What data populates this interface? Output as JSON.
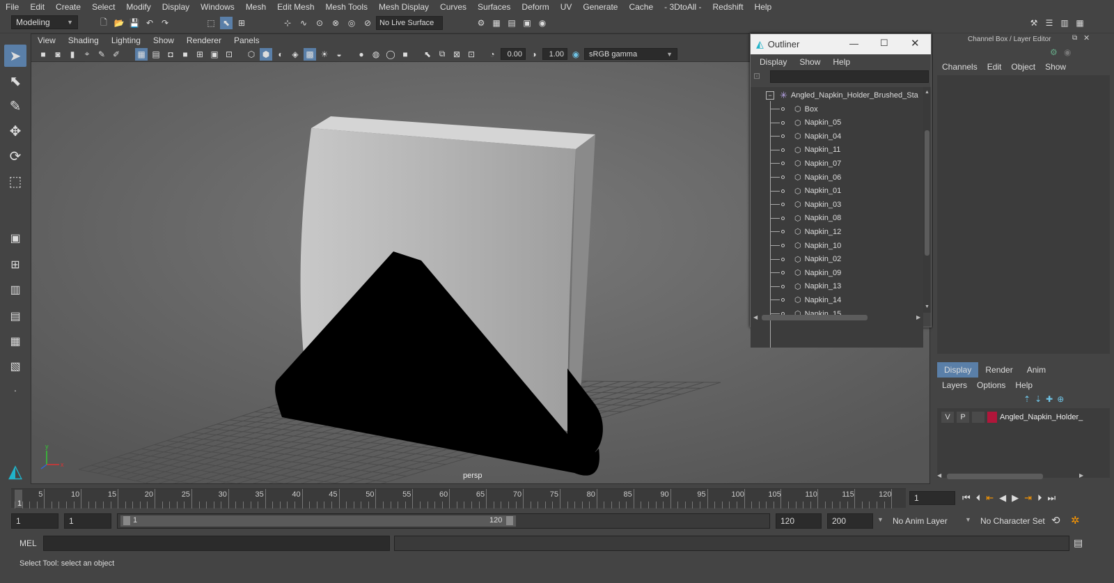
{
  "menu": [
    "File",
    "Edit",
    "Create",
    "Select",
    "Modify",
    "Display",
    "Windows",
    "Mesh",
    "Edit Mesh",
    "Mesh Tools",
    "Mesh Display",
    "Curves",
    "Surfaces",
    "Deform",
    "UV",
    "Generate",
    "Cache",
    "- 3DtoAll -",
    "Redshift",
    "Help"
  ],
  "shelf": {
    "mode": "Modeling",
    "live_surface": "No Live Surface"
  },
  "viewport": {
    "menu": [
      "View",
      "Shading",
      "Lighting",
      "Show",
      "Renderer",
      "Panels"
    ],
    "exposure": "0.00",
    "gamma": "1.00",
    "colorspace": "sRGB gamma",
    "camera_label": "persp"
  },
  "outliner": {
    "title": "Outliner",
    "menu": [
      "Display",
      "Show",
      "Help"
    ],
    "root": "Angled_Napkin_Holder_Brushed_Sta",
    "items": [
      "Box",
      "Napkin_05",
      "Napkin_04",
      "Napkin_11",
      "Napkin_07",
      "Napkin_06",
      "Napkin_01",
      "Napkin_03",
      "Napkin_08",
      "Napkin_12",
      "Napkin_10",
      "Napkin_02",
      "Napkin_09",
      "Napkin_13",
      "Napkin_14",
      "Napkin_15"
    ]
  },
  "channel_box": {
    "title": "Channel Box / Layer Editor",
    "menu": [
      "Channels",
      "Edit",
      "Object",
      "Show"
    ],
    "tabs": [
      "Display",
      "Render",
      "Anim"
    ],
    "layer_menu": [
      "Layers",
      "Options",
      "Help"
    ],
    "layer": {
      "v": "V",
      "p": "P",
      "name": "Angled_Napkin_Holder_",
      "color": "#b0163a"
    }
  },
  "timeline": {
    "ticks": [
      "5",
      "10",
      "15",
      "20",
      "25",
      "30",
      "35",
      "40",
      "45",
      "50",
      "55",
      "60",
      "65",
      "70",
      "75",
      "80",
      "85",
      "90",
      "95",
      "100",
      "105",
      "110",
      "115",
      "120"
    ],
    "start_marker": "1",
    "current_frame": "1"
  },
  "range": {
    "start": "1",
    "playback_start": "1",
    "slider_start": "1",
    "slider_end": "120",
    "playback_end": "120",
    "end": "200",
    "anim_layer": "No Anim Layer",
    "char_set": "No Character Set"
  },
  "cmd": {
    "label": "MEL"
  },
  "status": {
    "text": "Select Tool: select an object"
  }
}
